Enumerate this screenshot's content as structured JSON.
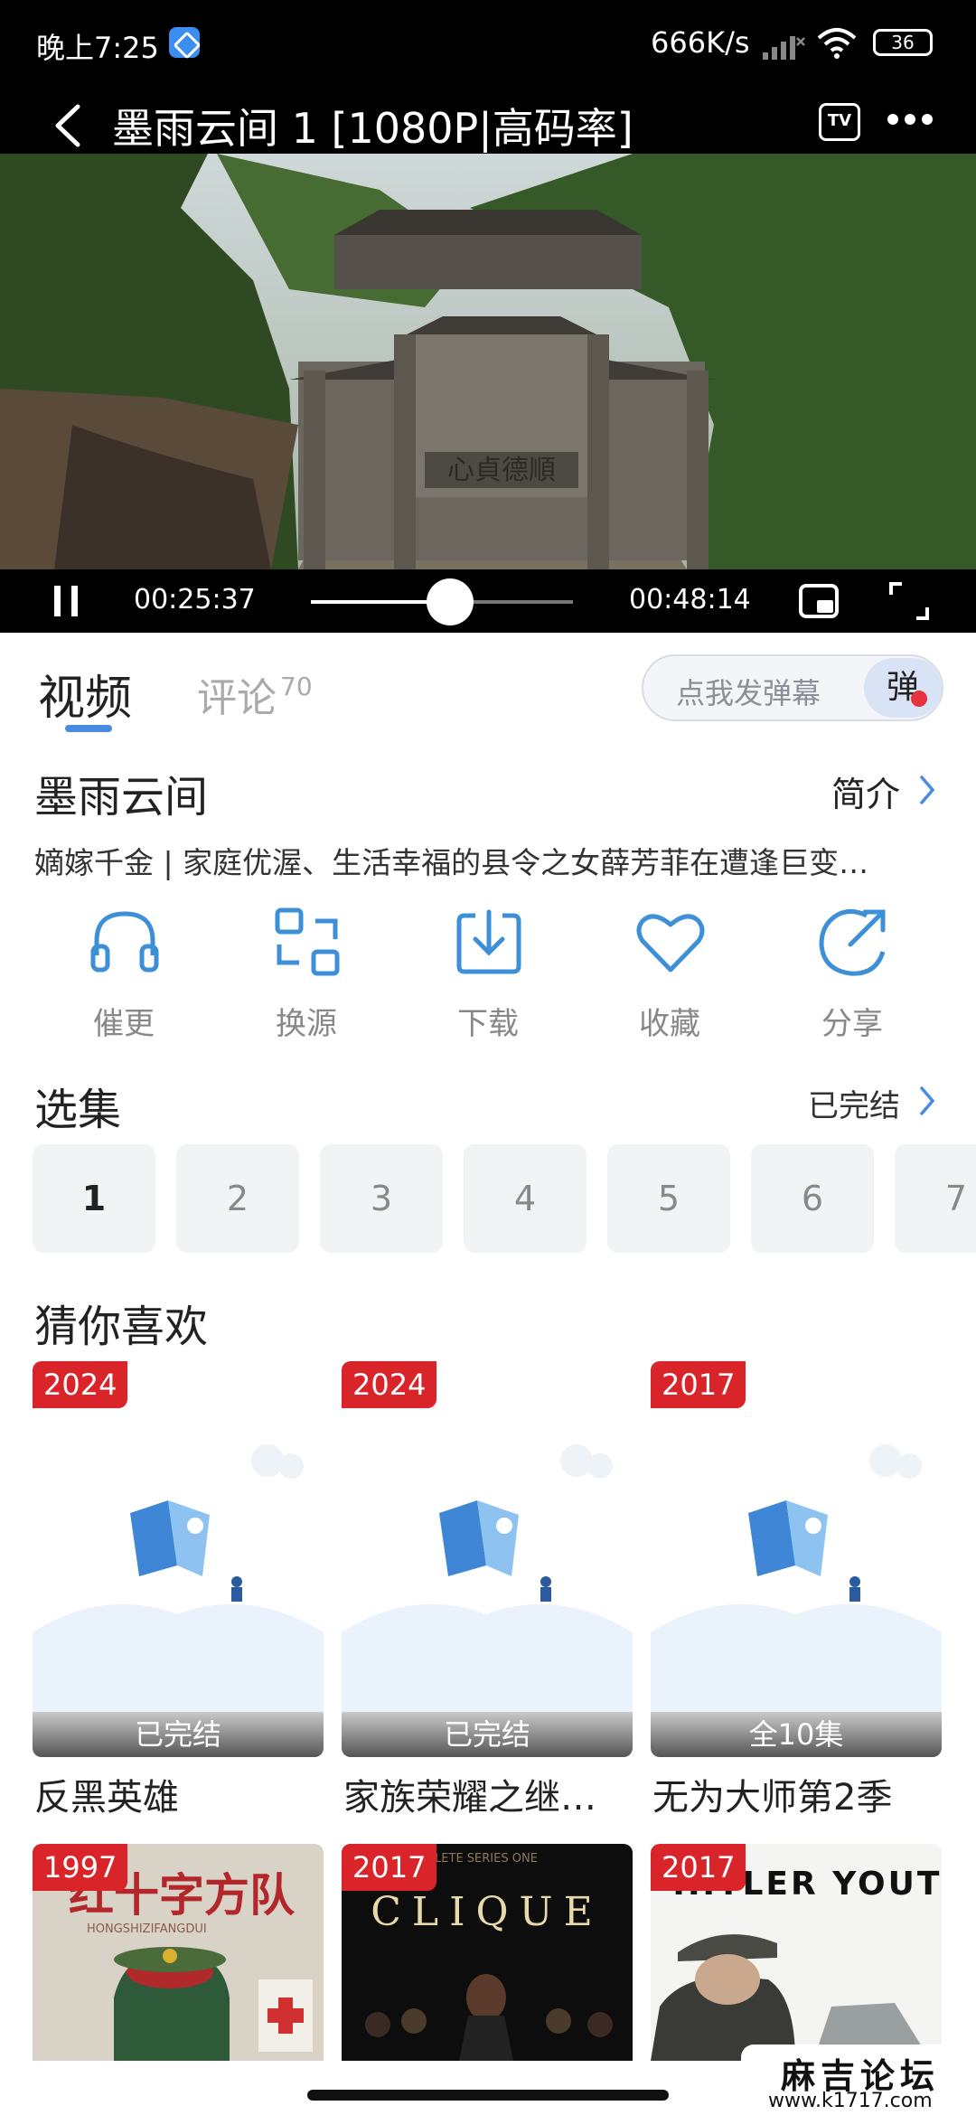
{
  "status_bar": {
    "time": "晚上7:25",
    "net_speed": "666K/s",
    "battery": "36",
    "icons": [
      "app-badge-icon",
      "signal-icon",
      "wifi-icon",
      "battery-icon"
    ]
  },
  "titlebar": {
    "title": "墨雨云间 1 [1080P|高码率]",
    "tv_label": "TV",
    "icons": [
      "back-arrow-icon",
      "tv-cast-icon",
      "more-icon"
    ]
  },
  "player": {
    "current_time": "00:25:37",
    "total_time": "00:48:14",
    "progress": 0.531,
    "sign_text": "心貞德順",
    "icons": [
      "pause-icon",
      "pip-icon",
      "fullscreen-icon"
    ]
  },
  "tabs": {
    "video": "视频",
    "comments": "评论",
    "comment_count": "70"
  },
  "danmu": {
    "placeholder": "点我发弹幕",
    "button": "弹"
  },
  "show": {
    "title": "墨雨云间",
    "intro_link": "简介",
    "description": "嫡嫁千金 | 家庭优渥、生活幸福的县令之女薛芳菲在遭逢巨变…"
  },
  "actions": [
    {
      "label": "催更",
      "icon": "headphones-icon"
    },
    {
      "label": "换源",
      "icon": "switch-source-icon"
    },
    {
      "label": "下载",
      "icon": "download-icon"
    },
    {
      "label": "收藏",
      "icon": "heart-icon"
    },
    {
      "label": "分享",
      "icon": "share-icon"
    }
  ],
  "episodes": {
    "title": "选集",
    "status": "已完结",
    "items": [
      "1",
      "2",
      "3",
      "4",
      "5",
      "6",
      "7"
    ],
    "selected": "1"
  },
  "recommendations": {
    "title": "猜你喜欢",
    "items": [
      {
        "year": "2024",
        "badge": "已完结",
        "name": "反黑英雄"
      },
      {
        "year": "2024",
        "badge": "已完结",
        "name": "家族荣耀之继…"
      },
      {
        "year": "2017",
        "badge": "全10集",
        "name": "无为大师第2季"
      },
      {
        "year": "1997",
        "poster_text": "红十字方队",
        "poster_sub": "HONGSHIZIFANGDUI"
      },
      {
        "year": "2017",
        "poster_text": "CLIQUE",
        "poster_sub": "LETE SERIES ONE"
      },
      {
        "year": "2017",
        "poster_text": "HITLER YOUTH"
      }
    ]
  },
  "watermark": {
    "name": "麻吉论坛",
    "url": "www.k1717.com"
  },
  "colors": {
    "accent": "#4a8be0",
    "year_badge": "#d9242a",
    "icon_blue": "#3d8fd8"
  }
}
